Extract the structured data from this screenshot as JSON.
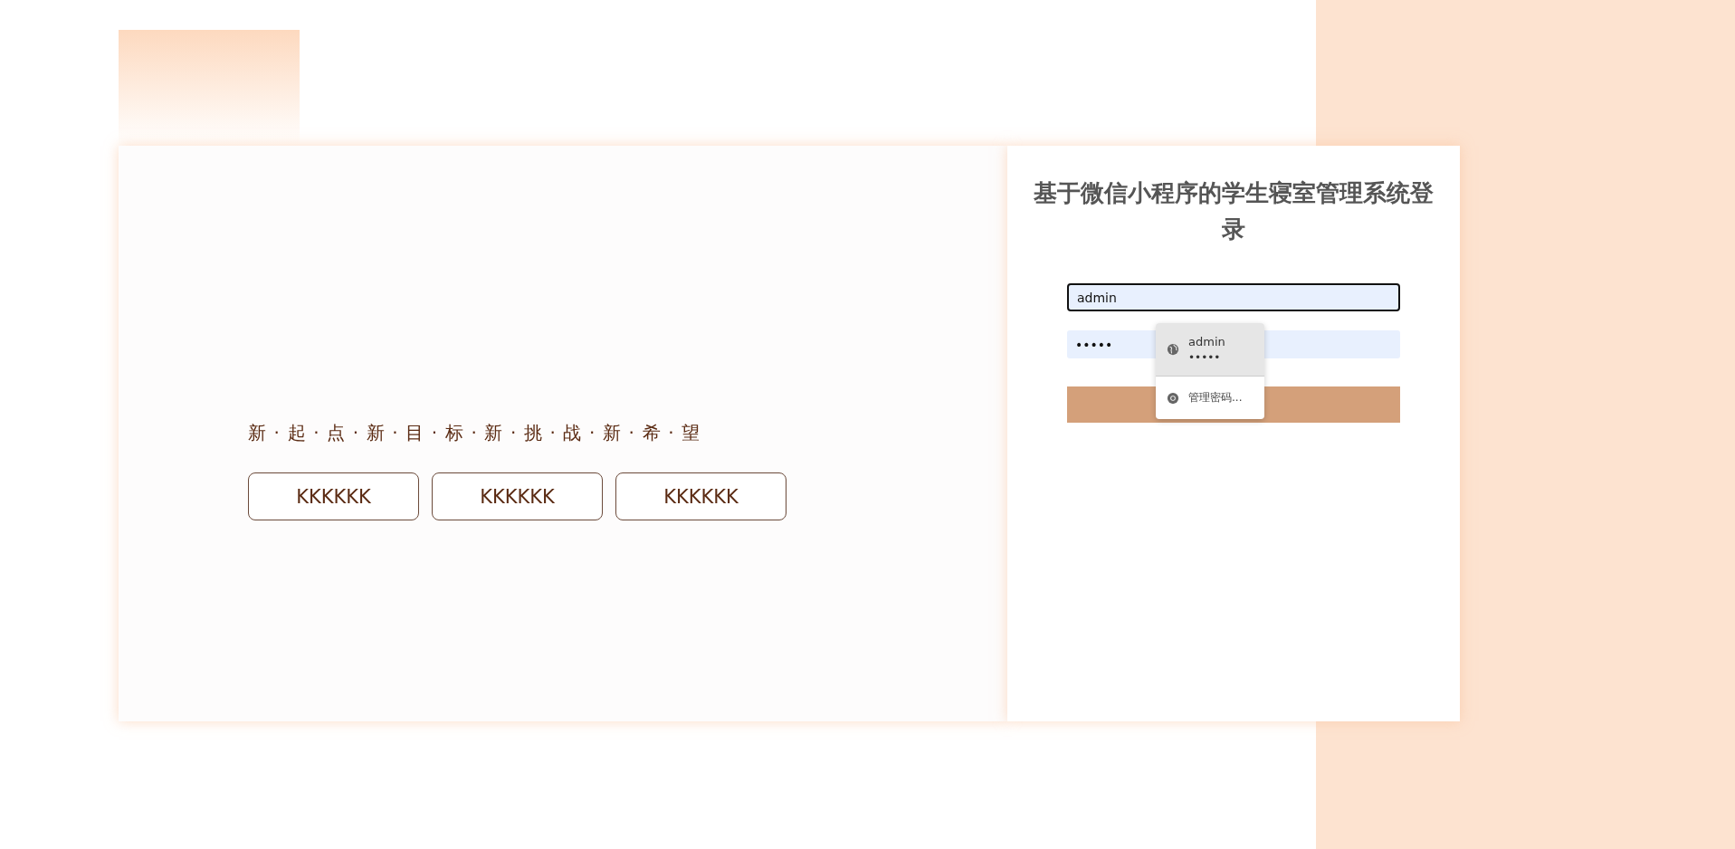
{
  "left_panel": {
    "tagline": "新·起·点·新·目·标·新·挑·战·新·希·望",
    "buttons": [
      "KKKKKK",
      "KKKKKK",
      "KKKKKK"
    ]
  },
  "login": {
    "title": "基于微信小程序的学生寝室管理系统登录",
    "username": {
      "value": "admin",
      "focused": true
    },
    "password": {
      "value": "•••••",
      "focused": false
    }
  },
  "autofill_popup": {
    "username": "admin",
    "password": "•••••",
    "manage_link": "管理密码..."
  }
}
